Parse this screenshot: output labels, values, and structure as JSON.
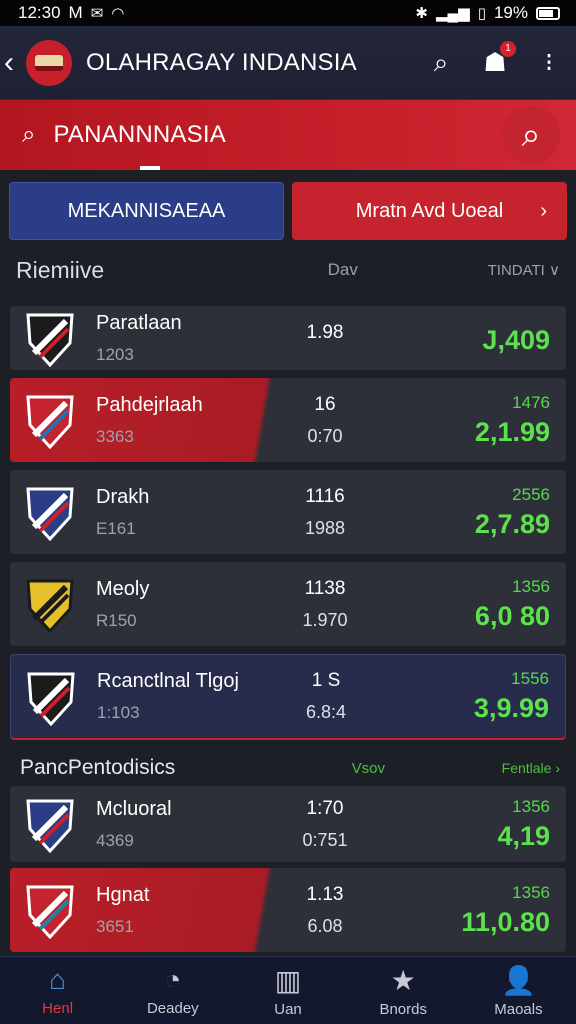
{
  "status_bar": {
    "time": "12:30",
    "indicator": "M",
    "battery_pct": "19%"
  },
  "header": {
    "title": "OLAHRAGAY INDANSIA",
    "notification_count": "1"
  },
  "search": {
    "text": "PANANNNASIA"
  },
  "actions": {
    "primary": "MEKANNISAEAA",
    "secondary": "Mratn Avd Uoeal"
  },
  "list_header": {
    "title": "Riemiive",
    "middle": "Dav",
    "right": "TINDATI ∨"
  },
  "rows": [
    {
      "name": "Paratlaan",
      "sub": "1203",
      "mid_a": "1.98",
      "mid_b": "",
      "r_small": "",
      "r_big": "J,409",
      "style": "plain"
    },
    {
      "name": "Pahdejrlaah",
      "sub": "3363",
      "mid_a": "16",
      "mid_b": "0:70",
      "r_small": "1476",
      "r_big": "2,1.99",
      "style": "red"
    },
    {
      "name": "Drakh",
      "sub": "E161",
      "mid_a": "1116",
      "mid_b": "1988",
      "r_small": "2556",
      "r_big": "2,7.89",
      "style": "plain"
    },
    {
      "name": "Meoly",
      "sub": "R150",
      "mid_a": "1138",
      "mid_b": "1.970",
      "r_small": "1356",
      "r_big": "6,0 80",
      "style": "plain"
    },
    {
      "name": "Rcanctlnal Tlgoj",
      "sub": "1:103",
      "mid_a": "1 S",
      "mid_b": "6.8:4",
      "r_small": "1556",
      "r_big": "3,9.99",
      "style": "blue"
    }
  ],
  "section2": {
    "title": "PancPentodisics",
    "middle": "Vsov",
    "right": "Fentlale ›"
  },
  "rows2": [
    {
      "name": "Mcluoral",
      "sub": "4369",
      "mid_a": "1:70",
      "mid_b": "0:751",
      "r_small": "1356",
      "r_big": "4,19",
      "style": "plain"
    },
    {
      "name": "Hgnat",
      "sub": "3651",
      "mid_a": "1.13",
      "mid_b": "6.08",
      "r_small": "1356",
      "r_big": "11,0.80",
      "style": "red"
    }
  ],
  "nav": [
    {
      "label": "Henl",
      "icon": "home-icon",
      "active": true
    },
    {
      "label": "Deadey",
      "icon": "ball-icon",
      "active": false
    },
    {
      "label": "Uan",
      "icon": "chart-icon",
      "active": false
    },
    {
      "label": "Bnords",
      "icon": "star-icon",
      "active": false
    },
    {
      "label": "Maoals",
      "icon": "user-icon",
      "active": false
    }
  ],
  "colors": {
    "accent_red": "#c5232d",
    "accent_blue": "#2a3d86",
    "positive_green": "#5de24d"
  }
}
